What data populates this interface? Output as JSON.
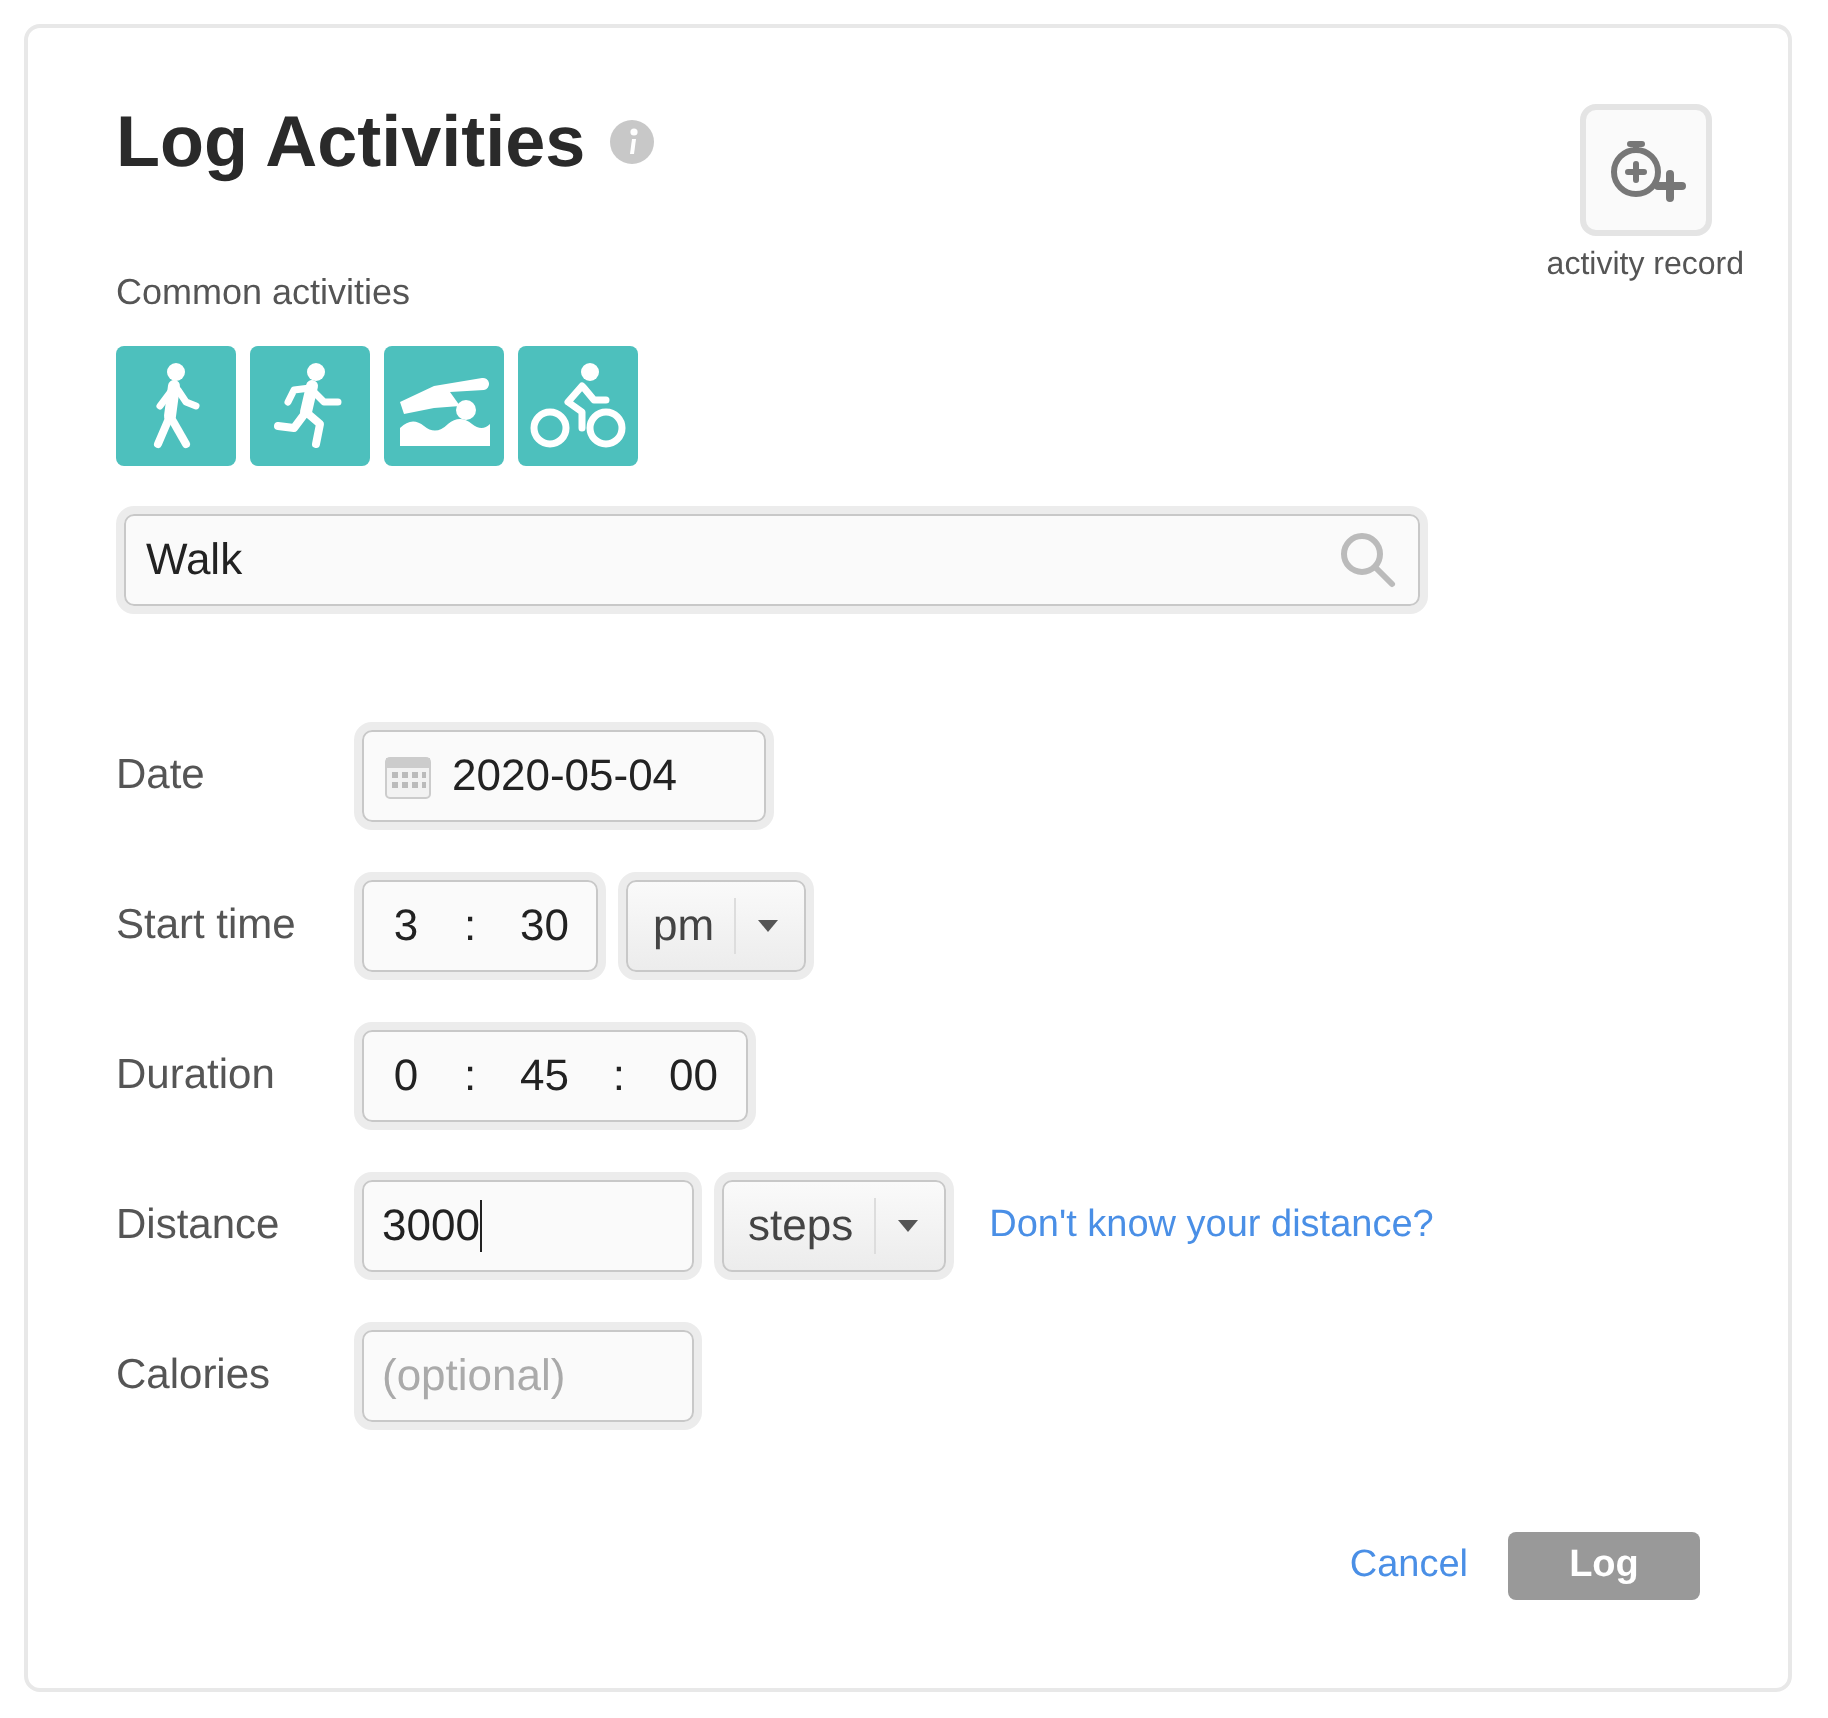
{
  "title": "Log Activities",
  "activity_record": {
    "label": "activity record"
  },
  "common_activities": {
    "label": "Common activities",
    "items": [
      {
        "kind": "walk"
      },
      {
        "kind": "run"
      },
      {
        "kind": "swim"
      },
      {
        "kind": "bike"
      }
    ]
  },
  "search": {
    "value": "Walk"
  },
  "form": [
    {
      "kind": "date",
      "label": "Date",
      "value": "2020-05-04"
    },
    {
      "kind": "time",
      "label": "Start time",
      "parts": [
        "3",
        "30"
      ],
      "separator": ":",
      "dropdown": "pm"
    },
    {
      "kind": "time",
      "label": "Duration",
      "parts": [
        "0",
        "45",
        "00"
      ],
      "separator": ":"
    },
    {
      "kind": "number",
      "label": "Distance",
      "value": "3000",
      "focused": true,
      "dropdown": "steps",
      "link": "Don't know your distance?"
    },
    {
      "kind": "number",
      "label": "Calories",
      "placeholder": "(optional)",
      "focused": false
    }
  ],
  "buttons": {
    "cancel": "Cancel",
    "log": "Log"
  }
}
